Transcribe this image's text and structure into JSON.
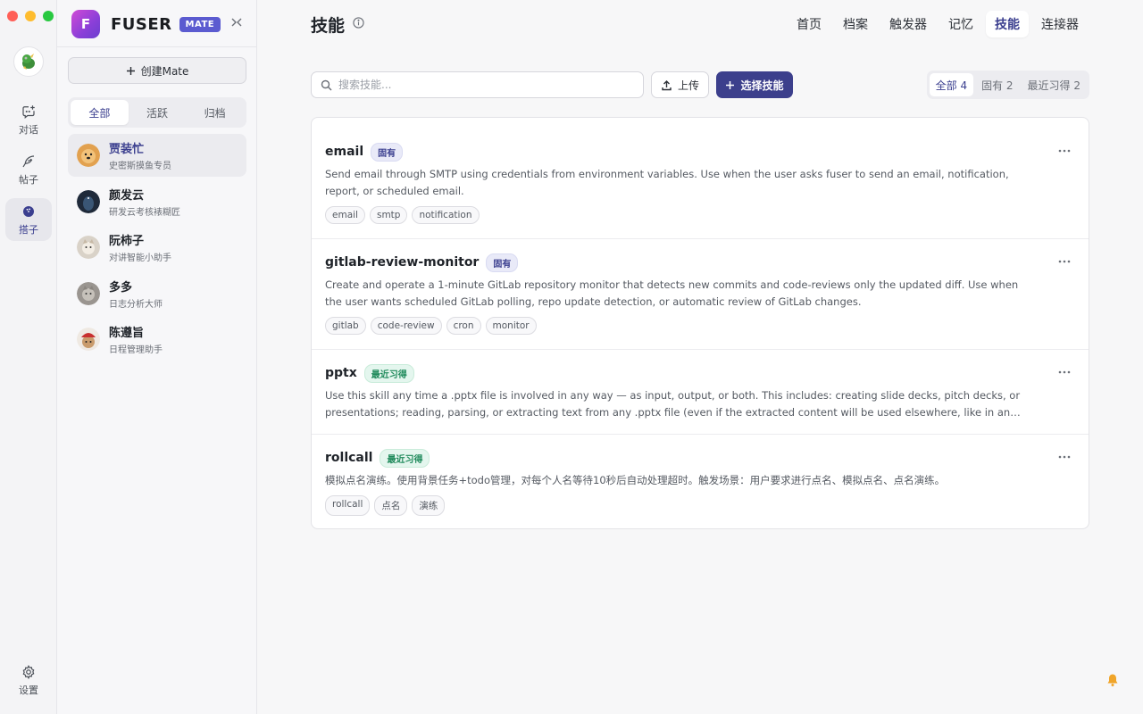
{
  "rail": {
    "items": [
      {
        "label": "对话",
        "icon": "chat-plus-icon"
      },
      {
        "label": "帖子",
        "icon": "feather-icon"
      },
      {
        "label": "搭子",
        "icon": "bowling-ball-icon"
      }
    ],
    "settings_label": "设置"
  },
  "sidebar": {
    "brand_letter": "F",
    "brand_name": "FUSER",
    "brand_badge": "MATE",
    "create_label": "创建Mate",
    "tabs": [
      "全部",
      "活跃",
      "归档"
    ],
    "mates": [
      {
        "name": "贾装忙",
        "desc": "史密斯摸鱼专员"
      },
      {
        "name": "颜发云",
        "desc": "研发云考核裱糊匠"
      },
      {
        "name": "阮柿子",
        "desc": "对讲智能小助手"
      },
      {
        "name": "多多",
        "desc": "日志分析大师"
      },
      {
        "name": "陈遵旨",
        "desc": "日程管理助手"
      }
    ]
  },
  "header": {
    "title": "技能",
    "nav": [
      "首页",
      "档案",
      "触发器",
      "记忆",
      "技能",
      "连接器"
    ]
  },
  "toolbar": {
    "search_placeholder": "搜索技能...",
    "upload_label": "上传",
    "select_label": "选择技能",
    "filters": [
      "全部 4",
      "固有 2",
      "最近习得 2"
    ]
  },
  "skills": [
    {
      "name": "email",
      "badge": "固有",
      "desc": "Send email through SMTP using credentials from environment variables. Use when the user asks fuser to send an email, notification, report, or scheduled email.",
      "tags": [
        "email",
        "smtp",
        "notification"
      ]
    },
    {
      "name": "gitlab-review-monitor",
      "badge": "固有",
      "desc": "Create and operate a 1-minute GitLab repository monitor that detects new commits and code-reviews only the updated diff. Use when the user wants scheduled GitLab polling, repo update detection, or automatic review of GitLab changes.",
      "tags": [
        "gitlab",
        "code-review",
        "cron",
        "monitor"
      ]
    },
    {
      "name": "pptx",
      "badge": "最近习得",
      "desc": "Use this skill any time a .pptx file is involved in any way — as input, output, or both. This includes: creating slide decks, pitch decks, or presentations; reading, parsing, or extracting text from any .pptx file (even if the extracted content will be used elsewhere, like in an email or...",
      "tags": []
    },
    {
      "name": "rollcall",
      "badge": "最近习得",
      "desc": "模拟点名演练。使用背景任务+todo管理，对每个人名等待10秒后自动处理超时。触发场景：用户要求进行点名、模拟点名、点名演练。",
      "tags": [
        "rollcall",
        "点名",
        "演练"
      ]
    }
  ]
}
